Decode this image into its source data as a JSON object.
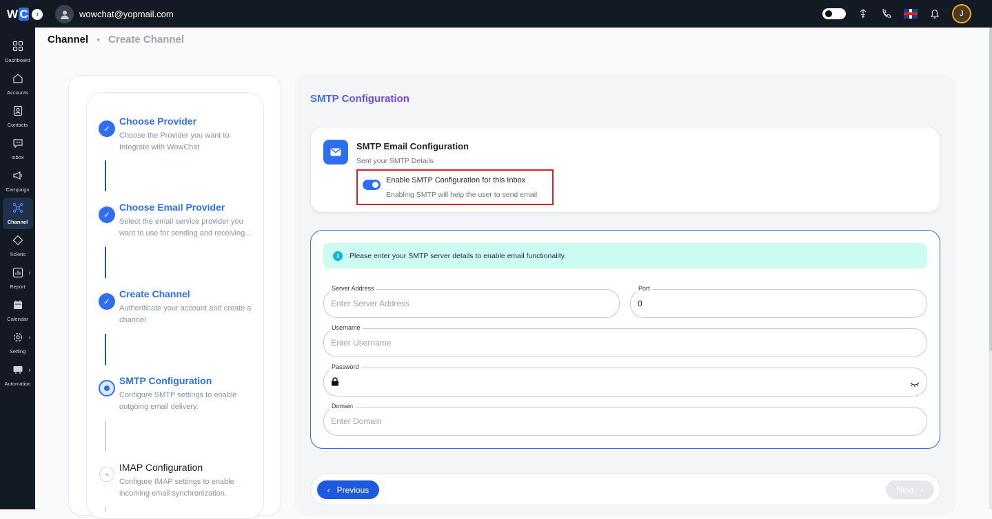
{
  "app": {
    "logo_text": "WC",
    "user_email": "wowchat@yopmail.com",
    "avatar_initial": "J"
  },
  "sidebar": {
    "items": [
      {
        "label": "Dashboard",
        "icon": "dashboard-icon",
        "chevron": false
      },
      {
        "label": "Accounts",
        "icon": "home-icon",
        "chevron": false
      },
      {
        "label": "Contacts",
        "icon": "contact-card-icon",
        "chevron": false
      },
      {
        "label": "Inbox",
        "icon": "chat-icon",
        "chevron": false
      },
      {
        "label": "Campaign",
        "icon": "megaphone-icon",
        "chevron": false
      },
      {
        "label": "Channel",
        "icon": "channel-icon",
        "chevron": false,
        "active": true
      },
      {
        "label": "Tickets",
        "icon": "ticket-icon",
        "chevron": false
      },
      {
        "label": "Report",
        "icon": "report-icon",
        "chevron": true
      },
      {
        "label": "Calendar",
        "icon": "calendar-icon",
        "chevron": false
      },
      {
        "label": "Setting",
        "icon": "gear-icon",
        "chevron": true
      },
      {
        "label": "Automation",
        "icon": "automation-icon",
        "chevron": true
      }
    ]
  },
  "breadcrumb": {
    "root": "Channel",
    "current": "Create Channel"
  },
  "steps": [
    {
      "title": "Choose Provider",
      "desc": "Choose the Provider you want to Integrate with WowChat",
      "state": "done"
    },
    {
      "title": "Choose Email Provider",
      "desc": "Select the email service provider you want to use for sending and receiving...",
      "state": "done"
    },
    {
      "title": "Create Channel",
      "desc": "Authenticate your account and create a channel",
      "state": "done"
    },
    {
      "title": "SMTP Configuration",
      "desc": "Configure SMTP settings to enable outgoing email delivery.",
      "state": "current"
    },
    {
      "title": "IMAP Configuration",
      "desc": "Configure IMAP settings to enable incoming email synchronization.",
      "state": "pending"
    }
  ],
  "panel": {
    "title": "SMTP Configuration"
  },
  "smtp_card": {
    "title": "SMTP Email Configuration",
    "subtitle": "Sent your SMTP Details",
    "toggle_label": "Enable SMTP Configuration for this Inbox",
    "toggle_sub": "Enabling SMTP will help the user to send email",
    "toggle_on": true
  },
  "form": {
    "info": "Please enter your SMTP server details to enable email functionality.",
    "server": {
      "label": "Server Address",
      "placeholder": "Enter Server Address"
    },
    "port": {
      "label": "Port",
      "value": "0"
    },
    "username": {
      "label": "Username",
      "placeholder": "Enter Username"
    },
    "password": {
      "label": "Password"
    },
    "domain": {
      "label": "Domain",
      "placeholder": "Enter Domain"
    }
  },
  "buttons": {
    "previous": "Previous",
    "next": "Next"
  }
}
